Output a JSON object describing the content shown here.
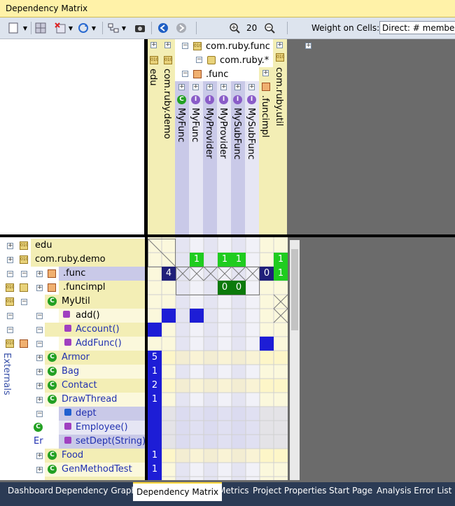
{
  "window": {
    "title": "Dependency Matrix"
  },
  "toolbar": {
    "zoom_value": "20",
    "weight_label": "Weight on Cells:",
    "weight_value": "Direct: # members"
  },
  "columns": [
    {
      "label": "edu",
      "icon": "assembly"
    },
    {
      "label": "com.ruby.demo",
      "icon": "assembly"
    },
    {
      "label": "MyFunc",
      "icon": "class"
    },
    {
      "label": "MyFunc",
      "icon": "interface"
    },
    {
      "label": "MyProvider",
      "icon": "interface"
    },
    {
      "label": "MyProvider",
      "icon": "interface"
    },
    {
      "label": "MySubFunc",
      "icon": "interface"
    },
    {
      "label": "MySubFunc",
      "icon": "interface"
    },
    {
      "label": ".funcimpl",
      "icon": "namespace"
    },
    {
      "label": "com.ruby.util",
      "icon": "assembly"
    }
  ],
  "column_groups": {
    "g1": "com.ruby.func",
    "g2": "com.ruby.*",
    "g3": ".func"
  },
  "rows": [
    {
      "label": "edu"
    },
    {
      "label": "com.ruby.demo"
    },
    {
      "label": ".func"
    },
    {
      "label": ".funcimpl"
    },
    {
      "label": "MyUtil"
    },
    {
      "label": "add()"
    },
    {
      "label": "Account()"
    },
    {
      "label": "AddFunc()"
    },
    {
      "label": "Armor"
    },
    {
      "label": "Bag"
    },
    {
      "label": "Contact"
    },
    {
      "label": "DrawThread"
    },
    {
      "label": "dept"
    },
    {
      "label": "Employee()"
    },
    {
      "label": "setDept(String)"
    },
    {
      "label": "Food"
    },
    {
      "label": "GenMethodTest"
    }
  ],
  "externals_label": "Externals",
  "cut_label": "Er",
  "matrix_values": {
    "r1c3": "1",
    "r1c5": "1",
    "r1c6": "1",
    "r1c9": "1",
    "r2c1": "4",
    "r2c8": "0",
    "r2c9": "1",
    "r3c5": "0",
    "r3c6": "0",
    "r8c0": "5",
    "r9c0": "1",
    "r10c0": "2",
    "r11c0": "1",
    "r15c0": "1",
    "r16c0": "1"
  },
  "tabs": [
    "Dashboard",
    "Dependency Graph",
    "Dependency Matrix",
    "Metrics",
    "Project Properties",
    "Start Page",
    "Analysis Error List"
  ],
  "active_tab": "Dependency Matrix",
  "colors": {
    "green": "#1fcc1f",
    "dark_green": "#0b7a0b",
    "blue": "#1d1dd6",
    "navy": "#20207a",
    "header_yellow": "#f3eeb5",
    "header_lavender": "#c9c9e8"
  }
}
